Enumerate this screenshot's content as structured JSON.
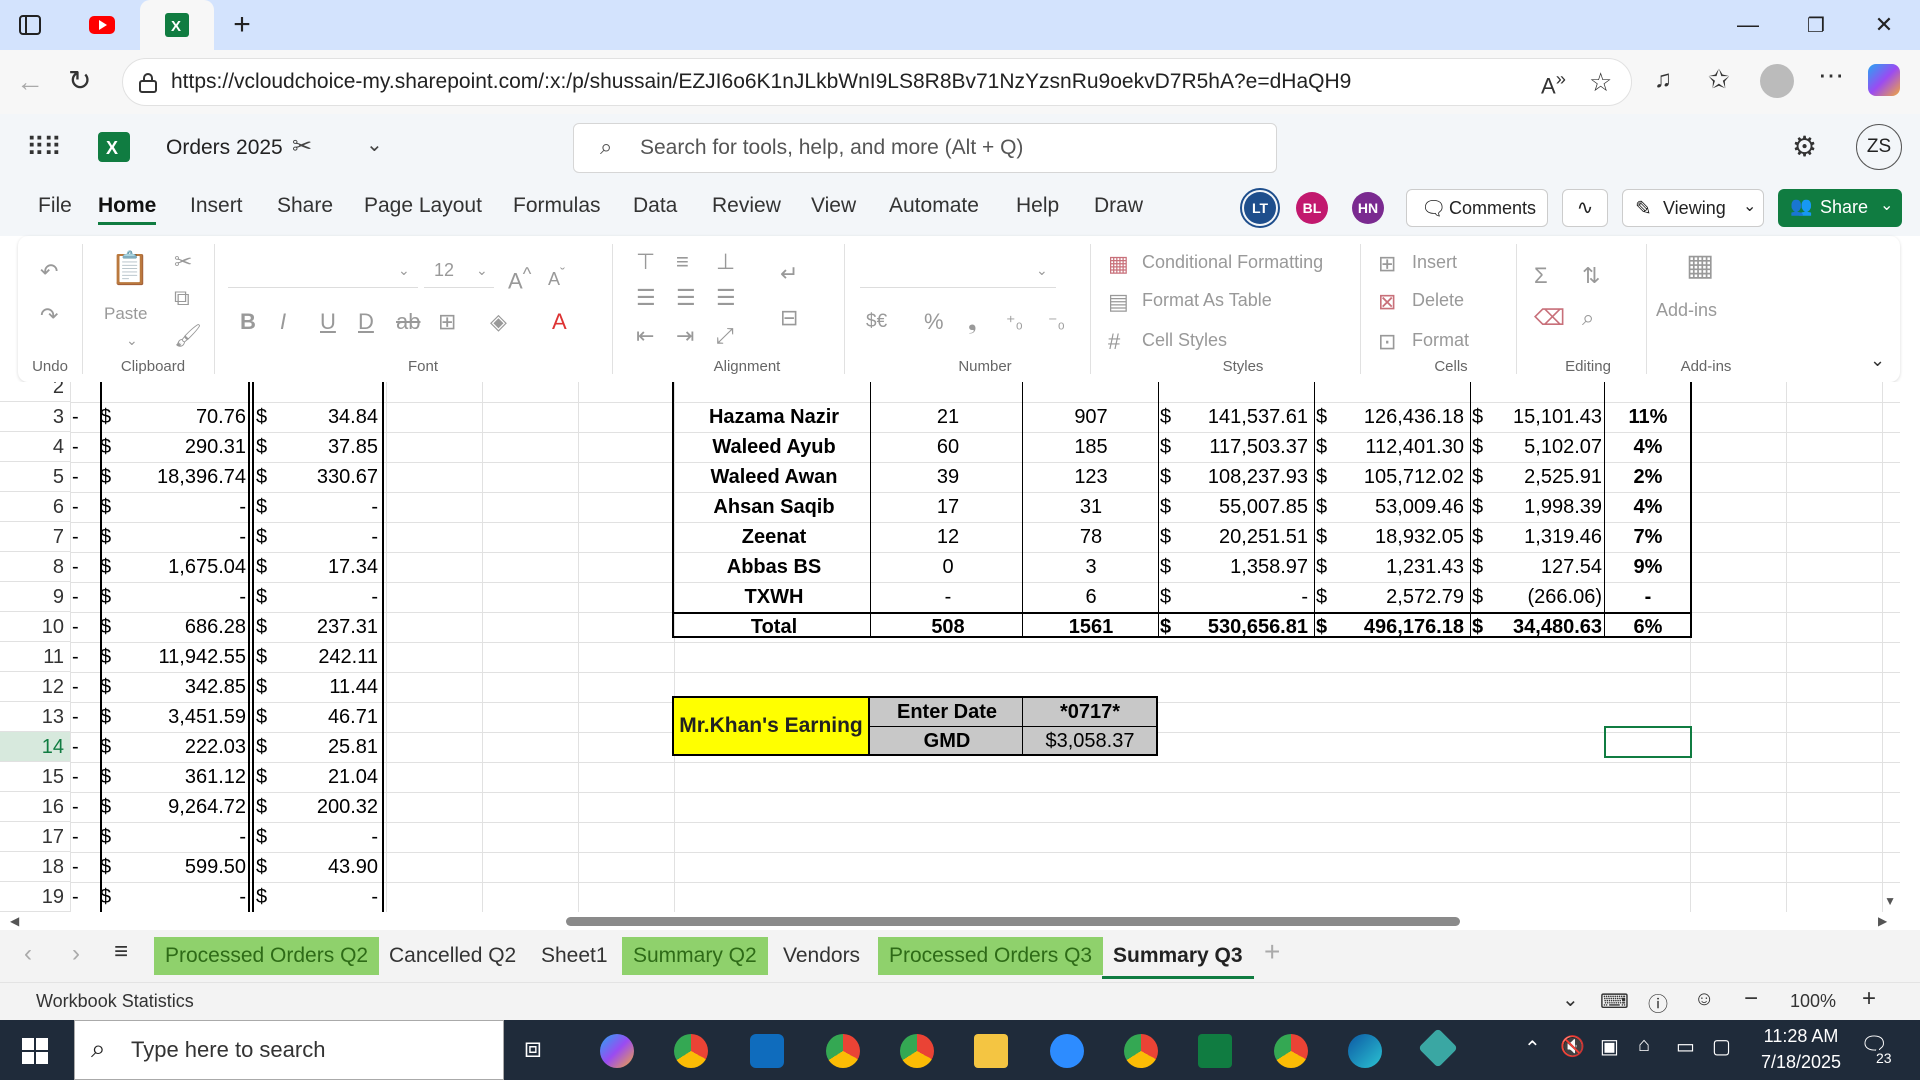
{
  "browser": {
    "url": "https://vcloudchoice-my.sharepoint.com/:x:/p/shussain/EZJI6o6K1nJLkbWnI9LS8R8Bv71NzYzsnRu9oekvD7R5hA?e=dHaQH9",
    "window_controls": {
      "minimize": "—",
      "restore": "❐",
      "close": "✕"
    }
  },
  "excel": {
    "doc_title": "Orders 2025",
    "search_placeholder": "Search for tools, help, and more (Alt + Q)",
    "avatar": "ZS",
    "menu": [
      "File",
      "Home",
      "Insert",
      "Share",
      "Page Layout",
      "Formulas",
      "Data",
      "Review",
      "View",
      "Automate",
      "Help",
      "Draw"
    ],
    "collaborators": [
      {
        "initials": "LT",
        "color": "#1e4e8c"
      },
      {
        "initials": "BL",
        "color": "#c2186e"
      },
      {
        "initials": "HN",
        "color": "#7a2a90"
      }
    ],
    "comments_label": "Comments",
    "viewing_label": "Viewing",
    "share_label": "Share",
    "ribbon": {
      "undo": "Undo",
      "clipboard": "Clipboard",
      "paste": "Paste",
      "font": "Font",
      "font_size": "12",
      "alignment": "Alignment",
      "number": "Number",
      "styles": "Styles",
      "conditional_formatting": "Conditional Formatting",
      "format_as_table": "Format As Table",
      "cell_styles": "Cell Styles",
      "cells": "Cells",
      "insert": "Insert",
      "delete": "Delete",
      "format": "Format",
      "editing": "Editing",
      "addins": "Add-ins",
      "addins_group": "Add-ins"
    }
  },
  "sheet": {
    "row_numbers": [
      "2",
      "3",
      "4",
      "5",
      "6",
      "7",
      "8",
      "9",
      "10",
      "11",
      "12",
      "13",
      "14",
      "15",
      "16",
      "17",
      "18",
      "19"
    ],
    "left_cols": [
      {
        "b": "70.76",
        "c": "34.84"
      },
      {
        "b": "290.31",
        "c": "37.85"
      },
      {
        "b": "18,396.74",
        "c": "330.67"
      },
      {
        "b": "-",
        "c": "-"
      },
      {
        "b": "-",
        "c": "-"
      },
      {
        "b": "1,675.04",
        "c": "17.34"
      },
      {
        "b": "-",
        "c": "-"
      },
      {
        "b": "686.28",
        "c": "237.31"
      },
      {
        "b": "11,942.55",
        "c": "242.11"
      },
      {
        "b": "342.85",
        "c": "11.44"
      },
      {
        "b": "3,451.59",
        "c": "46.71"
      },
      {
        "b": "222.03",
        "c": "25.81"
      },
      {
        "b": "361.12",
        "c": "21.04"
      },
      {
        "b": "9,264.72",
        "c": "200.32"
      },
      {
        "b": "-",
        "c": "-"
      },
      {
        "b": "599.50",
        "c": "43.90"
      },
      {
        "b": "-",
        "c": "-"
      }
    ],
    "summary": [
      {
        "name": "Hazama Nazir",
        "a": "21",
        "b": "907",
        "s": "141,537.61",
        "c": "126,436.18",
        "p": "15,101.43",
        "m": "11%"
      },
      {
        "name": "Waleed Ayub",
        "a": "60",
        "b": "185",
        "s": "117,503.37",
        "c": "112,401.30",
        "p": "5,102.07",
        "m": "4%"
      },
      {
        "name": "Waleed Awan",
        "a": "39",
        "b": "123",
        "s": "108,237.93",
        "c": "105,712.02",
        "p": "2,525.91",
        "m": "2%"
      },
      {
        "name": "Ahsan Saqib",
        "a": "17",
        "b": "31",
        "s": "55,007.85",
        "c": "53,009.46",
        "p": "1,998.39",
        "m": "4%"
      },
      {
        "name": "Zeenat",
        "a": "12",
        "b": "78",
        "s": "20,251.51",
        "c": "18,932.05",
        "p": "1,319.46",
        "m": "7%"
      },
      {
        "name": "Abbas BS",
        "a": "0",
        "b": "3",
        "s": "1,358.97",
        "c": "1,231.43",
        "p": "127.54",
        "m": "9%"
      },
      {
        "name": "TXWH",
        "a": "-",
        "b": "6",
        "s": "-",
        "c": "2,572.79",
        "p": "(266.06)",
        "m": "-"
      },
      {
        "name": "Total",
        "a": "508",
        "b": "1561",
        "s": "530,656.81",
        "c": "496,176.18",
        "p": "34,480.63",
        "m": "6%"
      }
    ],
    "earning_label": "Mr.Khan's Earning",
    "enter_date_label": "Enter Date",
    "date_value": "*0717*",
    "gmd_label": "GMD",
    "gmd_value": "$3,058.37",
    "currency_symbol": "$"
  },
  "sheet_tabs": [
    {
      "label": "Processed Orders Q2",
      "style": "green"
    },
    {
      "label": "Cancelled Q2",
      "style": "plain"
    },
    {
      "label": "Sheet1",
      "style": "plain"
    },
    {
      "label": "Summary Q2",
      "style": "green"
    },
    {
      "label": "Vendors",
      "style": "plain"
    },
    {
      "label": "Processed Orders Q3",
      "style": "green"
    },
    {
      "label": "Summary Q3",
      "style": "active"
    }
  ],
  "status": {
    "left": "Workbook Statistics",
    "zoom": "100%"
  },
  "taskbar": {
    "search_placeholder": "Type here to search",
    "time": "11:28 AM",
    "date": "7/18/2025",
    "notif_count": "23"
  }
}
